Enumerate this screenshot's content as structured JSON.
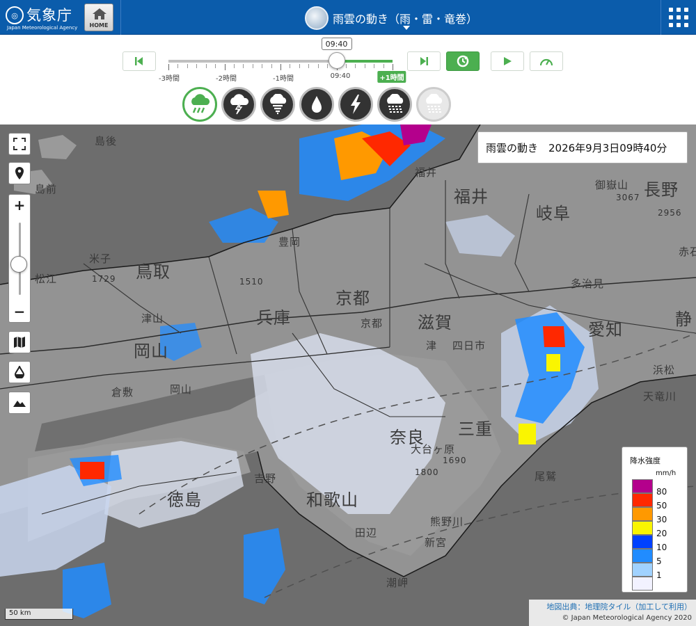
{
  "header": {
    "agency_name": "気象庁",
    "agency_en": "Japan Meteorological Agency",
    "home_label": "HOME",
    "page_title": "雨雲の動き（雨・雷・竜巻）",
    "bg_color": "#0b5cab"
  },
  "timeline": {
    "current_time": "09:40",
    "ticks": [
      "-3時間",
      "-2時間",
      "-1時間",
      "09:40",
      "+1時間"
    ],
    "current_fraction": 0.75,
    "accent_color": "#4caf50"
  },
  "controls": {
    "first_icon": "skip-first-icon",
    "last_icon": "skip-last-icon",
    "latest_icon": "refresh-icon",
    "play_icon": "play-icon",
    "speed_icon": "speedometer-icon"
  },
  "elements": [
    {
      "icon": "rain-cloud-icon",
      "state": "selected"
    },
    {
      "icon": "thunder-cloud-icon",
      "state": "normal"
    },
    {
      "icon": "tornado-cloud-icon",
      "state": "normal"
    },
    {
      "icon": "raindrop-icon",
      "state": "normal"
    },
    {
      "icon": "lightning-icon",
      "state": "normal"
    },
    {
      "icon": "hail-cloud-icon",
      "state": "normal"
    },
    {
      "icon": "snow-cloud-icon",
      "state": "disabled"
    }
  ],
  "map": {
    "info_title": "雨雲の動き　2026年9月3日09時40分",
    "places": {
      "okayama_big": "岡山",
      "tottori": "鳥取",
      "hyogo": "兵庫",
      "kyoto": "京都",
      "shiga": "滋賀",
      "fukui": "福井",
      "gifu": "岐阜",
      "nagano": "長野",
      "aichi": "愛知",
      "shizuoka": "静",
      "mie": "三重",
      "nara": "奈良",
      "wakayama": "和歌山",
      "tokushima": "徳島",
      "oki_n": "島後",
      "oki_s": "島前",
      "matsue": "松江",
      "yonago": "米子",
      "tsuyama": "津山",
      "kurashiki": "倉敷",
      "okayama": "岡山",
      "kyoto_city": "京都",
      "fukui_city": "福井",
      "tsu": "津",
      "yokkaichi": "四日市",
      "tajimi": "多治見",
      "hamamatsu": "浜松",
      "tanabe": "田辺",
      "shingu": "新宮",
      "kumanogawa": "熊野川",
      "owase": "尾鷲",
      "ontake": "御嶽山",
      "ontake_h": "3067",
      "h2956": "2956",
      "h1510": "1510",
      "h1729": "1729",
      "h1690": "1690",
      "h1800": "1800",
      "yoshino": "吉野",
      "toyooka": "豊岡",
      "akaishi": "赤石",
      "tenryu": "天竜川",
      "odaigahara": "大台ヶ原",
      "shionomisaki": "潮岬"
    },
    "legend_title": "降水強度",
    "legend_unit": "mm/h",
    "legend": [
      {
        "value": "80",
        "color": "#b4008c"
      },
      {
        "value": "50",
        "color": "#ff2800"
      },
      {
        "value": "30",
        "color": "#ff9900"
      },
      {
        "value": "20",
        "color": "#faf500"
      },
      {
        "value": "10",
        "color": "#0041ff"
      },
      {
        "value": "5",
        "color": "#218cff"
      },
      {
        "value": "1",
        "color": "#a0d2ff"
      },
      {
        "value": "",
        "color": "#f2f2ff"
      }
    ],
    "scale_label": "50 km",
    "attribution": "地図出典：地理院タイル（加工して利用）",
    "copyright": "© Japan Meteorological Agency 2020"
  }
}
